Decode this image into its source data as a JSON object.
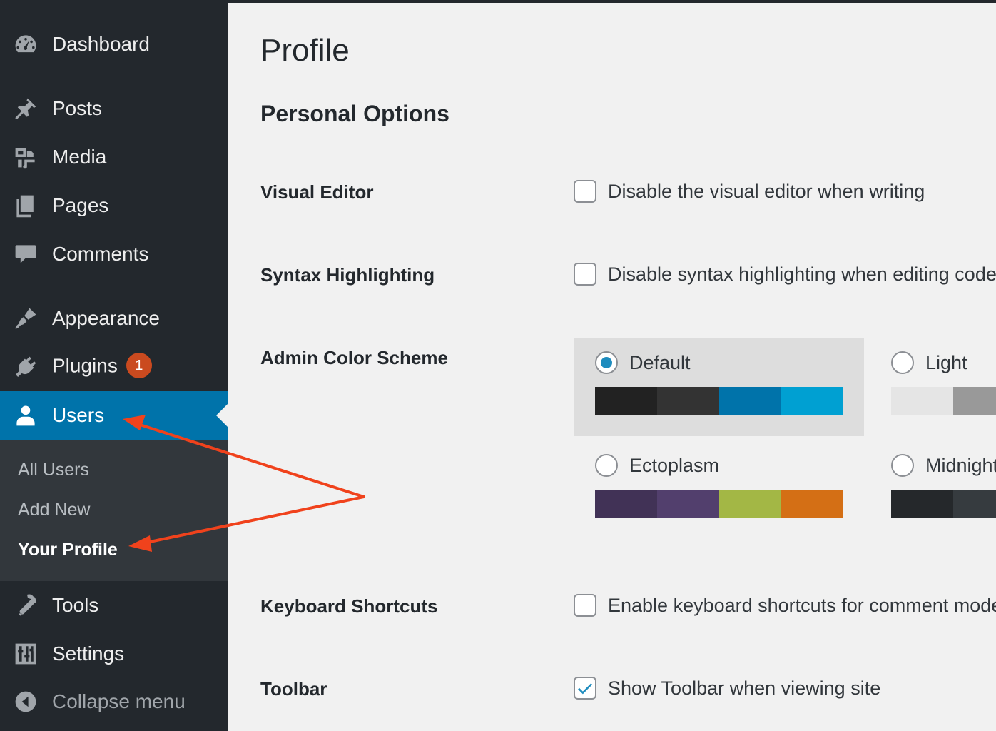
{
  "sidebar": {
    "items": [
      {
        "key": "dashboard",
        "label": "Dashboard",
        "icon": "dashboard-icon"
      },
      {
        "key": "posts",
        "label": "Posts",
        "icon": "pushpin-icon"
      },
      {
        "key": "media",
        "label": "Media",
        "icon": "media-icon"
      },
      {
        "key": "pages",
        "label": "Pages",
        "icon": "pages-icon"
      },
      {
        "key": "comments",
        "label": "Comments",
        "icon": "comment-bubble-icon"
      },
      {
        "key": "appearance",
        "label": "Appearance",
        "icon": "paintbrush-icon"
      },
      {
        "key": "plugins",
        "label": "Plugins",
        "icon": "plug-icon",
        "badge": "1"
      },
      {
        "key": "users",
        "label": "Users",
        "icon": "user-icon",
        "current": true
      },
      {
        "key": "tools",
        "label": "Tools",
        "icon": "wrench-icon"
      },
      {
        "key": "settings",
        "label": "Settings",
        "icon": "sliders-icon"
      },
      {
        "key": "collapse",
        "label": "Collapse menu",
        "icon": "collapse-arrow-icon"
      }
    ],
    "submenu": [
      {
        "label": "All Users"
      },
      {
        "label": "Add New"
      },
      {
        "label": "Your Profile",
        "current": true
      }
    ]
  },
  "main": {
    "title": "Profile",
    "section": "Personal Options",
    "rows": {
      "visual_editor": {
        "label": "Visual Editor",
        "option": "Disable the visual editor when writing",
        "checked": false
      },
      "syntax": {
        "label": "Syntax Highlighting",
        "option": "Disable syntax highlighting when editing code",
        "checked": false
      },
      "color_scheme": {
        "label": "Admin Color Scheme"
      },
      "keyboard": {
        "label": "Keyboard Shortcuts",
        "option": "Enable keyboard shortcuts for comment moderation",
        "checked": false
      },
      "toolbar": {
        "label": "Toolbar",
        "option": "Show Toolbar when viewing site",
        "checked": true
      }
    },
    "schemes": [
      {
        "name": "Default",
        "selected": true,
        "colors": [
          "#222222",
          "#333333",
          "#0073aa",
          "#00a0d2"
        ]
      },
      {
        "name": "Light",
        "selected": false,
        "colors": [
          "#e5e5e5",
          "#999999",
          "#d64e07",
          "#04a4cc"
        ]
      },
      {
        "name": "Ectoplasm",
        "selected": false,
        "colors": [
          "#413256",
          "#523f6d",
          "#a3b745",
          "#d46f15"
        ]
      },
      {
        "name": "Midnight",
        "selected": false,
        "colors": [
          "#25282b",
          "#363b3f",
          "#69a8bb",
          "#e14d43"
        ]
      }
    ]
  },
  "annotation": {
    "arrow_color": "#f0421c"
  }
}
